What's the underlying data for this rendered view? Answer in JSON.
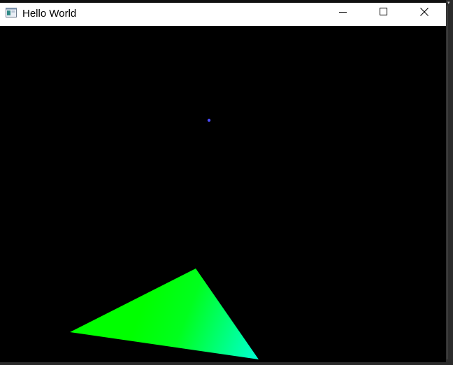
{
  "window": {
    "title": "Hello World",
    "caption_buttons": {
      "minimize": "minimize",
      "maximize": "maximize",
      "close": "close"
    }
  },
  "icons": {
    "app": "app-window-icon",
    "minimize": "minimize-icon",
    "maximize": "maximize-icon",
    "close": "close-icon"
  },
  "scene": {
    "background_color": "#000000",
    "point": {
      "color": "#4a4aff"
    },
    "triangle": {
      "vertex_colors": [
        "#00ff00",
        "#00ff1e",
        "#00ffd6"
      ]
    }
  }
}
